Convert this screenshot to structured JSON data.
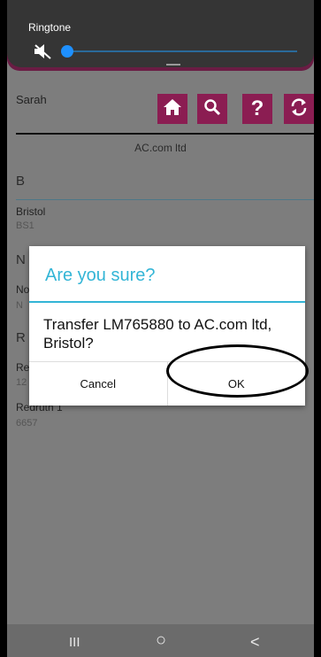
{
  "volume": {
    "label": "Ringtone",
    "level": 0,
    "icons": [
      "mute-icon"
    ]
  },
  "topbar": {
    "user": "Sarah",
    "buttons": [
      {
        "name": "home",
        "icon": "home-icon"
      },
      {
        "name": "search",
        "icon": "search-icon"
      },
      {
        "name": "help",
        "icon": "help-icon"
      },
      {
        "name": "refresh",
        "icon": "refresh-icon"
      }
    ]
  },
  "company": "AC.com ltd",
  "sections": [
    {
      "header": "B",
      "items": [
        {
          "name": "Bristol",
          "sub": "BS1"
        }
      ]
    },
    {
      "header": "N",
      "items": [
        {
          "name": "No",
          "sub": "N"
        }
      ]
    },
    {
      "header": "R",
      "items": [
        {
          "name": "Re",
          "sub": "12"
        },
        {
          "name": "Redruth 1",
          "sub": "6657"
        }
      ]
    }
  ],
  "dialog": {
    "title": "Are you sure?",
    "message": "Transfer LM765880 to AC.com ltd, Bristol?",
    "cancel_label": "Cancel",
    "ok_label": "OK"
  },
  "navbar": {
    "recent": "III",
    "home": "○",
    "back": "<"
  },
  "colors": {
    "accent": "#8b1d52",
    "dialog_accent": "#33b5d6",
    "slider": "#1e90ff"
  }
}
